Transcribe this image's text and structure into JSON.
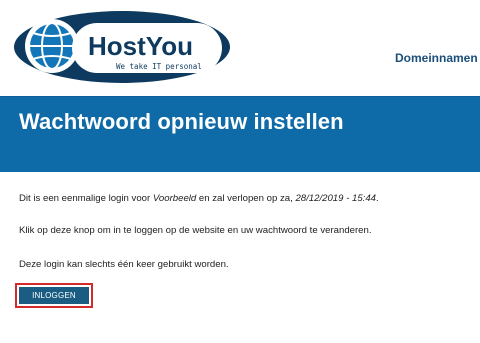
{
  "brand": {
    "name": "HostYou",
    "tagline": "We take IT personal",
    "colors": {
      "navy": "#0d3a5e",
      "blue": "#1376b8",
      "banner": "#0f6aa8",
      "button": "#1a5c82",
      "highlight": "#d22b2b"
    }
  },
  "nav": {
    "domains_label": "Domeinnamen"
  },
  "banner": {
    "title": "Wachtwoord opnieuw instellen"
  },
  "content": {
    "p1_before": "Dit is een eenmalige login voor ",
    "p1_site": "Voorbeeld",
    "p1_middle": " en zal verlopen op za, ",
    "p1_date": "28/12/2019 - 15:44",
    "p1_end": ".",
    "p2": "Klik op deze knop om in te loggen op de website en uw wachtwoord te veranderen.",
    "p3": "Deze login kan slechts één keer gebruikt worden."
  },
  "login_button": {
    "label": "INLOGGEN"
  }
}
